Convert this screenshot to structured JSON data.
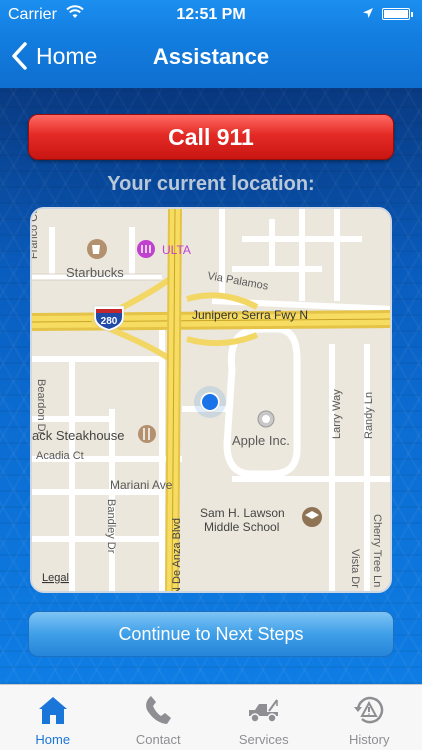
{
  "status_bar": {
    "carrier": "Carrier",
    "time": "12:51 PM"
  },
  "nav": {
    "back_label": "Home",
    "title": "Assistance"
  },
  "call_button": {
    "label": "Call 911",
    "color": "#e42a25"
  },
  "location_label": "Your current location:",
  "map": {
    "highway_shield": "280",
    "labels": {
      "franco": "Franco Ct",
      "starbucks": "Starbucks",
      "ulta": "ULTA",
      "via_palamos": "Via Palamos",
      "junipero": "Junipero Serra Fwy N",
      "beardon": "Beardon Dr",
      "steakhouse": "ack Steakhouse",
      "acadia": "Acadia Ct",
      "apple": "Apple Inc.",
      "larry": "Larry Way",
      "randy": "Randy Ln",
      "mariani": "Mariani Ave",
      "bandley": "Bandley Dr",
      "de_anza": "N De Anza Blvd",
      "school": "Sam H. Lawson Middle School",
      "school_line1": "Sam H. Lawson",
      "school_line2": "Middle School",
      "vista": "Vista Dr",
      "cherry": "Cherry Tree Ln",
      "legal": "Legal"
    }
  },
  "continue_button": {
    "label": "Continue to Next Steps"
  },
  "tabs": [
    {
      "label": "Home",
      "icon": "house-icon",
      "active": true
    },
    {
      "label": "Contact",
      "icon": "phone-icon",
      "active": false
    },
    {
      "label": "Services",
      "icon": "tow-truck-icon",
      "active": false
    },
    {
      "label": "History",
      "icon": "history-icon",
      "active": false
    }
  ],
  "colors": {
    "accent": "#1a76d8",
    "nav": "#137ee0",
    "map_bg": "#ece7dc"
  }
}
